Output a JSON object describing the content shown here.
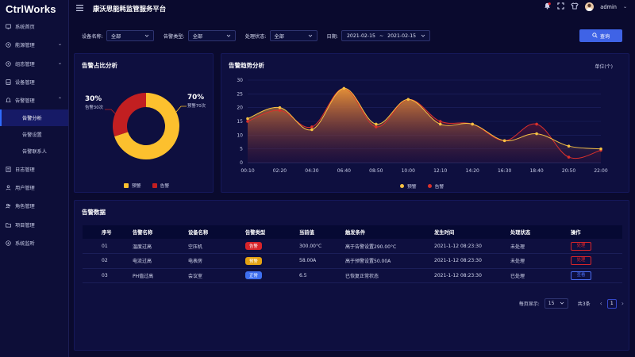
{
  "app": {
    "logo": "CtrlWorks",
    "title": "康沃思能耗监管服务平台"
  },
  "header": {
    "user": "admin",
    "notification_count": ""
  },
  "sidebar": {
    "items": [
      {
        "label": "系统首页",
        "icon": "monitor-icon"
      },
      {
        "label": "能源管理",
        "icon": "target-icon",
        "chevron": "⌄"
      },
      {
        "label": "组态管理",
        "icon": "target-icon",
        "chevron": "⌄"
      },
      {
        "label": "设备管理",
        "icon": "device-icon"
      },
      {
        "label": "告警管理",
        "icon": "alarm-icon",
        "chevron": "⌃"
      }
    ],
    "sub_items": [
      {
        "label": "告警分析",
        "active": true
      },
      {
        "label": "告警设置"
      },
      {
        "label": "告警联系人"
      }
    ],
    "items_after": [
      {
        "label": "日志管理",
        "icon": "log-icon"
      },
      {
        "label": "用户管理",
        "icon": "user-icon"
      },
      {
        "label": "角色管理",
        "icon": "role-icon"
      },
      {
        "label": "项目管理",
        "icon": "project-icon"
      },
      {
        "label": "系统监听",
        "icon": "listen-icon"
      }
    ]
  },
  "filters": {
    "device_label": "设备名称:",
    "device_value": "全部",
    "alarm_type_label": "告警类型:",
    "alarm_type_value": "全部",
    "status_label": "处理状态:",
    "status_value": "全部",
    "date_label": "日期:",
    "date_start": "2021-02-15",
    "date_sep": "~",
    "date_end": "2021-02-15",
    "query_button": "查询"
  },
  "pie_panel": {
    "title": "告警占比分析",
    "left_pct": "30%",
    "left_sub": "告警30次",
    "right_pct": "70%",
    "right_sub": "预警70次",
    "legend": [
      "预警",
      "告警"
    ]
  },
  "trend_panel": {
    "title": "告警趋势分析",
    "unit": "单位(个)",
    "legend": [
      "预警",
      "告警"
    ]
  },
  "chart_data": [
    {
      "type": "pie",
      "labels": [
        "预警",
        "告警"
      ],
      "values": [
        70,
        30
      ],
      "colors": [
        "#fcc02e",
        "#c21f21"
      ],
      "donut": true
    },
    {
      "type": "area",
      "x": [
        "00:10",
        "02:20",
        "04:30",
        "06:40",
        "08:50",
        "10:00",
        "12:10",
        "14:20",
        "16:30",
        "18:40",
        "20:50",
        "22:00"
      ],
      "ylim": [
        0,
        30
      ],
      "yticks": [
        0,
        5,
        10,
        15,
        20,
        25,
        30
      ],
      "series": [
        {
          "name": "预警",
          "color": "#f5c143",
          "values": [
            16,
            20,
            12,
            27,
            14,
            23,
            14,
            14,
            8,
            10.5,
            6,
            5
          ]
        },
        {
          "name": "告警",
          "color": "#d9302b",
          "values": [
            15,
            19,
            13,
            27,
            13,
            23,
            15,
            14,
            8,
            14,
            2,
            4.5
          ]
        }
      ],
      "legend_position": "bottom-center",
      "grid": true
    }
  ],
  "table": {
    "title": "告警数据",
    "headers": [
      "序号",
      "告警名称",
      "设备名称",
      "告警类型",
      "当前值",
      "触发条件",
      "发生时间",
      "处理状态",
      "操作"
    ],
    "rows": [
      {
        "no": "01",
        "name": "温度过高",
        "device": "空压机",
        "type": "告警",
        "type_color": "#d7242a",
        "value": "300.00°C",
        "condition": "高于告警设置290.00°C",
        "time": "2021-1-12  08:23:30",
        "status": "未处理",
        "op": "处理",
        "op_color": "#d7242a"
      },
      {
        "no": "02",
        "name": "电流过高",
        "device": "电表房",
        "type": "预警",
        "type_color": "#e3a112",
        "value": "58.00A",
        "condition": "高于预警设置50.00A",
        "time": "2021-1-12  08:23:30",
        "status": "未处理",
        "op": "处理",
        "op_color": "#d7242a"
      },
      {
        "no": "03",
        "name": "PH值过高",
        "device": "会议室",
        "type": "正常",
        "type_color": "#3e6ff0",
        "value": "6.5",
        "condition": "已恢复正常状态",
        "time": "2021-1-12  08:23:30",
        "status": "已处理",
        "op": "查看",
        "op_color": "#4a6cf0"
      }
    ]
  },
  "pager": {
    "per_page_label": "每页显示:",
    "per_page": "15",
    "total": "共3条",
    "current": "1",
    "prev": "‹",
    "next": "›"
  }
}
